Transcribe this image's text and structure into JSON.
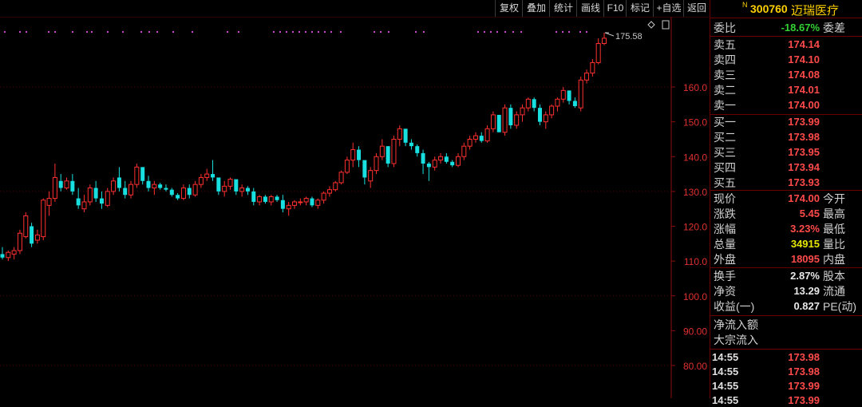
{
  "toolbar": {
    "buttons": [
      "复权",
      "叠加",
      "统计",
      "画线",
      "F10",
      "标记",
      "+自选",
      "返回"
    ]
  },
  "chart": {
    "y_axis_ticks": [
      "160.0",
      "150.0",
      "140.0",
      "130.0",
      "120.0",
      "110.0",
      "100.0",
      "90.00",
      "80.00"
    ],
    "high_label": "175.58",
    "corner_icon": "diamond-icon"
  },
  "chart_data": {
    "type": "candlestick",
    "ylim": [
      75,
      181
    ],
    "up_color": "#ff3030",
    "down_color": "#18e0e0",
    "candles": [
      [
        112,
        114,
        110.5,
        111
      ],
      [
        111,
        113,
        110,
        112.5
      ],
      [
        112,
        114,
        110.5,
        113
      ],
      [
        113,
        119,
        112,
        118
      ],
      [
        117,
        124,
        116.5,
        123
      ],
      [
        120,
        121,
        114,
        115
      ],
      [
        116,
        119,
        115,
        117.5
      ],
      [
        117,
        128,
        116,
        127.5
      ],
      [
        126,
        130,
        123,
        128
      ],
      [
        128,
        138,
        127,
        134
      ],
      [
        133,
        135,
        130,
        131
      ],
      [
        131,
        134,
        130.5,
        133
      ],
      [
        133,
        135,
        129,
        130
      ],
      [
        128,
        131,
        125,
        126
      ],
      [
        125,
        129,
        124,
        127
      ],
      [
        127,
        132,
        126,
        131
      ],
      [
        131,
        133,
        127,
        128
      ],
      [
        128,
        130,
        125,
        126.5
      ],
      [
        126,
        131,
        125.5,
        130
      ],
      [
        130,
        134,
        129,
        133
      ],
      [
        134,
        137,
        130,
        131
      ],
      [
        131,
        133,
        128,
        129
      ],
      [
        129,
        133,
        128,
        132
      ],
      [
        132,
        138,
        131,
        137
      ],
      [
        137,
        136.5,
        132,
        133
      ],
      [
        133,
        134.5,
        130,
        131
      ],
      [
        131,
        133,
        129,
        132
      ],
      [
        132,
        132.5,
        130.5,
        131
      ],
      [
        131,
        132,
        130,
        130.5
      ],
      [
        130.5,
        131,
        128.5,
        129
      ],
      [
        129,
        129.5,
        127.5,
        128
      ],
      [
        128,
        132,
        127.5,
        131
      ],
      [
        131,
        132,
        128,
        129
      ],
      [
        129,
        133,
        128.5,
        132
      ],
      [
        132,
        135,
        131,
        134
      ],
      [
        134,
        136.5,
        133,
        135
      ],
      [
        135,
        139,
        133,
        134
      ],
      [
        134,
        133,
        129,
        130
      ],
      [
        130,
        133,
        128.5,
        131.5
      ],
      [
        131.5,
        134,
        130.5,
        133.5
      ],
      [
        133.5,
        133,
        129,
        130
      ],
      [
        130,
        132,
        128.5,
        131
      ],
      [
        131,
        131.5,
        129,
        130
      ],
      [
        130,
        131,
        126,
        127
      ],
      [
        127,
        129,
        126,
        128.5
      ],
      [
        128.5,
        129,
        126.5,
        127
      ],
      [
        127,
        129,
        126,
        128.5
      ],
      [
        128.5,
        129,
        127,
        127.5
      ],
      [
        127.5,
        129,
        124,
        125
      ],
      [
        125,
        127,
        123,
        126
      ],
      [
        126,
        127.5,
        125,
        127
      ],
      [
        127,
        128,
        126,
        127
      ],
      [
        127,
        128.5,
        126,
        128
      ],
      [
        128,
        128.5,
        125.5,
        126
      ],
      [
        126,
        128,
        125,
        127.5
      ],
      [
        127.5,
        130,
        126.5,
        129.5
      ],
      [
        129.5,
        131.5,
        128.5,
        130.5
      ],
      [
        130.5,
        133,
        130,
        132.5
      ],
      [
        132.5,
        136,
        132,
        135.5
      ],
      [
        135.5,
        140,
        135,
        139
      ],
      [
        139,
        144,
        137,
        142
      ],
      [
        142,
        143,
        137,
        139
      ],
      [
        139,
        138,
        132,
        134
      ],
      [
        133,
        137,
        131,
        136
      ],
      [
        136,
        141,
        135,
        140
      ],
      [
        140,
        145,
        139,
        143
      ],
      [
        143,
        142,
        137,
        138
      ],
      [
        138,
        146,
        137,
        145
      ],
      [
        145,
        149,
        143,
        148
      ],
      [
        148,
        148,
        143,
        144
      ],
      [
        144,
        145,
        142,
        143
      ],
      [
        143,
        143.5,
        140,
        141
      ],
      [
        141,
        142,
        135,
        138
      ],
      [
        138,
        138.5,
        133,
        137
      ],
      [
        137,
        140,
        136,
        139
      ],
      [
        139,
        141,
        138,
        140
      ],
      [
        140,
        141,
        138,
        138.5
      ],
      [
        138.5,
        139,
        137,
        137.5
      ],
      [
        137.5,
        141,
        137,
        140
      ],
      [
        140,
        144,
        139,
        143
      ],
      [
        143,
        146,
        142,
        145
      ],
      [
        145,
        147,
        144,
        146
      ],
      [
        146,
        147,
        144,
        144.5
      ],
      [
        144.5,
        149,
        144,
        148
      ],
      [
        148,
        153,
        147,
        152
      ],
      [
        152,
        151,
        147,
        147
      ],
      [
        147,
        155,
        146,
        154
      ],
      [
        154,
        155,
        148,
        149
      ],
      [
        149,
        153,
        148,
        152
      ],
      [
        152,
        155,
        150,
        154
      ],
      [
        154,
        157,
        153,
        156.5
      ],
      [
        156.5,
        157,
        153,
        154
      ],
      [
        154,
        155,
        149,
        150
      ],
      [
        150,
        153,
        148,
        152
      ],
      [
        152,
        155,
        151,
        154.5
      ],
      [
        154.5,
        157,
        153,
        156.5
      ],
      [
        156.5,
        160,
        155.5,
        159
      ],
      [
        159,
        158,
        155,
        156
      ],
      [
        156,
        157,
        154,
        154.5
      ],
      [
        154,
        163,
        153,
        162
      ],
      [
        162,
        165,
        161,
        164
      ],
      [
        164,
        168,
        163,
        167
      ],
      [
        167,
        174,
        166.5,
        172.5
      ],
      [
        172.5,
        175.58,
        172,
        174
      ]
    ]
  },
  "stock": {
    "marker": "N",
    "code": "300760",
    "name": "迈瑞医疗"
  },
  "quote": {
    "weibi_label": "委比",
    "weibi_value": "-18.67%",
    "weicha_label": "委差",
    "sell": [
      {
        "label": "卖五",
        "price": "174.14"
      },
      {
        "label": "卖四",
        "price": "174.10"
      },
      {
        "label": "卖三",
        "price": "174.08"
      },
      {
        "label": "卖二",
        "price": "174.01"
      },
      {
        "label": "卖一",
        "price": "174.00"
      }
    ],
    "buy": [
      {
        "label": "买一",
        "price": "173.99"
      },
      {
        "label": "买二",
        "price": "173.98"
      },
      {
        "label": "买三",
        "price": "173.95"
      },
      {
        "label": "买四",
        "price": "173.94"
      },
      {
        "label": "买五",
        "price": "173.93"
      }
    ],
    "stats1": [
      {
        "label": "现价",
        "value": "174.00",
        "label2": "今开",
        "color": "red"
      },
      {
        "label": "涨跌",
        "value": "5.45",
        "label2": "最高",
        "color": "red"
      },
      {
        "label": "涨幅",
        "value": "3.23%",
        "label2": "最低",
        "color": "red"
      },
      {
        "label": "总量",
        "value": "34915",
        "label2": "量比",
        "color": "yellow"
      },
      {
        "label": "外盘",
        "value": "18095",
        "label2": "内盘",
        "color": "red"
      }
    ],
    "stats2": [
      {
        "label": "换手",
        "value": "2.87%",
        "label2": "股本",
        "color": "white"
      },
      {
        "label": "净资",
        "value": "13.29",
        "label2": "流通",
        "color": "white"
      },
      {
        "label": "收益(一)",
        "value": "0.827",
        "label2": "PE(动)",
        "color": "white"
      }
    ],
    "flow": [
      "净流入额",
      "大宗流入"
    ],
    "ticks": [
      {
        "time": "14:55",
        "price": "173.98"
      },
      {
        "time": "14:55",
        "price": "173.98"
      },
      {
        "time": "14:55",
        "price": "173.99"
      },
      {
        "time": "14:55",
        "price": "173.99"
      }
    ]
  }
}
